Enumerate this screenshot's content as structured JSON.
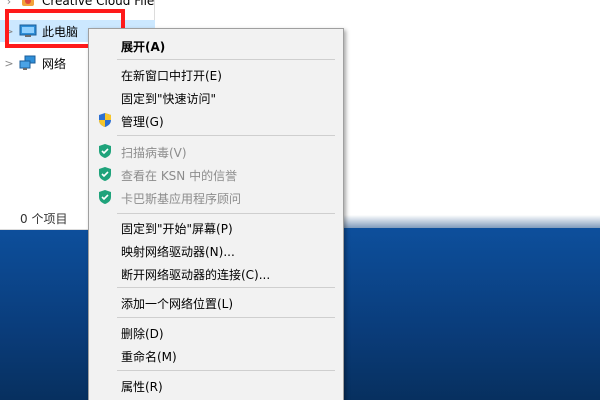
{
  "nav_pane": {
    "items": [
      {
        "label": "Creative Cloud File",
        "icon": "creative-cloud-icon"
      },
      {
        "label": "此电脑",
        "icon": "this-pc-icon",
        "chevron": ">"
      },
      {
        "label": "网络",
        "icon": "network-icon",
        "chevron": ">"
      }
    ],
    "item_count": "0 个项目"
  },
  "context_menu": {
    "items": [
      {
        "label": "展开(A)",
        "bold": true
      },
      {
        "label": "在新窗口中打开(E)"
      },
      {
        "label": "固定到\"快速访问\""
      },
      {
        "label": "管理(G)",
        "icon": "uac-shield-icon"
      },
      {
        "label": "扫描病毒(V)",
        "icon": "kaspersky-shield-icon",
        "disabled": true
      },
      {
        "label": "查看在 KSN 中的信誉",
        "icon": "kaspersky-shield-icon",
        "disabled": true
      },
      {
        "label": "卡巴斯基应用程序顾问",
        "icon": "kaspersky-shield-icon",
        "disabled": true
      },
      {
        "label": "固定到\"开始\"屏幕(P)"
      },
      {
        "label": "映射网络驱动器(N)..."
      },
      {
        "label": "断开网络驱动器的连接(C)..."
      },
      {
        "label": "添加一个网络位置(L)"
      },
      {
        "label": "删除(D)"
      },
      {
        "label": "重命名(M)"
      },
      {
        "label": "属性(R)"
      }
    ]
  },
  "colors": {
    "highlight_border": "#ff1a1a",
    "selected_bg": "#cce8ff",
    "menu_bg": "#f2f2f2",
    "kaspersky_green": "#1fa37b",
    "desktop_blue": "#0a3c7a"
  }
}
